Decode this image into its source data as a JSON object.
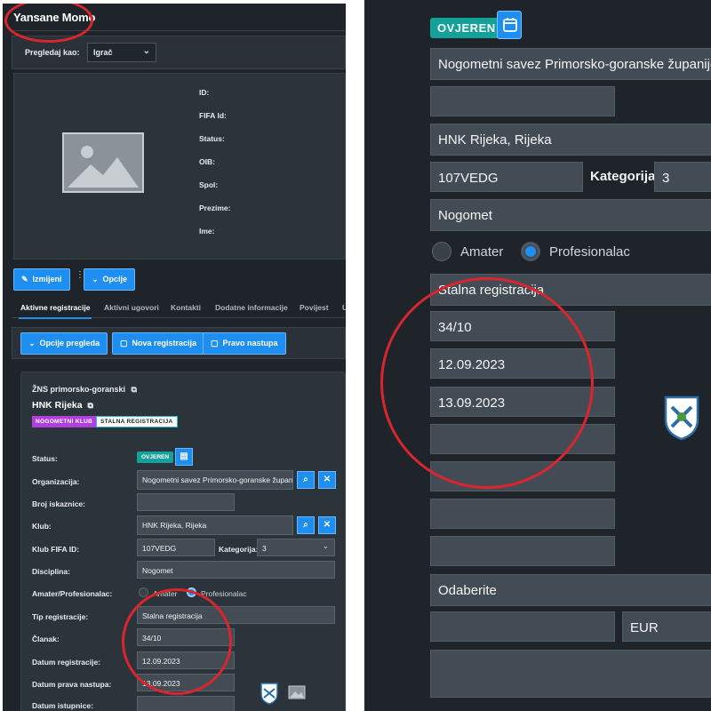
{
  "left": {
    "title": "Yansane Momo",
    "view_label": "Pregledaj kao:",
    "view_select": "Igrač",
    "info_labels": [
      "ID:",
      "FIFA Id:",
      "Status:",
      "OIB:",
      "Spol:",
      "Prezime:",
      "Ime:"
    ],
    "edit_button": "Izmijeni",
    "options_button": "Opcije",
    "tabs": [
      "Aktivne registracije",
      "Aktivni ugovori",
      "Kontakti",
      "Dodatne informacije",
      "Povijest",
      "U"
    ],
    "toolbar": {
      "view_options": "Opcije pregleda",
      "new_registration": "Nova registracija",
      "play_right": "Pravo nastupa"
    },
    "registration": {
      "org_header": "ŽNS primorsko-goranski",
      "club_header": "HNK Rijeka",
      "badge_club": "NOGOMETNI KLUB",
      "badge_reg": "STALNA REGISTRACIJA",
      "status_label": "Status:",
      "status_value": "OVJEREN",
      "organization_label": "Organizacija:",
      "organization_value": "Nogometni savez Primorsko-goranske županij",
      "card_number_label": "Broj iskaznice:",
      "card_number_value": "",
      "club_label": "Klub:",
      "club_value": "HNK Rijeka, Rijeka",
      "club_fifa_label": "Klub FIFA ID:",
      "club_fifa_value": "107VEDG",
      "category_label": "Kategorija:",
      "category_value": "3",
      "discipline_label": "Disciplina:",
      "discipline_value": "Nogomet",
      "amateur_pro_label": "Amater/Profesionalac:",
      "amateur": "Amater",
      "professional": "Profesionalac",
      "reg_type_label": "Tip registracije:",
      "reg_type_value": "Stalna registracija",
      "article_label": "Članak:",
      "article_value": "34/10",
      "reg_date_label": "Datum registracije:",
      "reg_date_value": "12.09.2023",
      "play_date_label": "Datum prava nastupa:",
      "play_date_value": "13.09.2023",
      "exit_date_label": "Datum istupnice:",
      "exit_date_value": ""
    }
  },
  "right": {
    "status_value": "OVJEREN",
    "organization_value": "Nogometni savez Primorsko-goranske županije",
    "club_value": "HNK Rijeka, Rijeka",
    "club_fifa_value": "107VEDG",
    "category_label": "Kategorija:",
    "category_value": "3",
    "discipline_value": "Nogomet",
    "amateur": "Amater",
    "professional": "Profesionalac",
    "reg_type_value": "Stalna registracija",
    "article_value": "34/10",
    "reg_date_value": "12.09.2023",
    "play_date_value": "13.09.2023",
    "select_placeholder": "Odaberite",
    "currency_value": "EUR"
  },
  "colors": {
    "background": "#1e2429",
    "panel": "#2b333b",
    "input": "#434c54",
    "accent_blue": "#1f8ef1",
    "status_teal": "#14a19a",
    "badge_purple": "#b03fe0",
    "annotation_red": "#d9262e"
  },
  "icons": [
    "image-placeholder-icon",
    "pencil-icon",
    "chevron-down-icon",
    "file-icon",
    "external-link-icon",
    "calendar-icon",
    "search-icon",
    "close-icon",
    "club-crest-icon"
  ]
}
